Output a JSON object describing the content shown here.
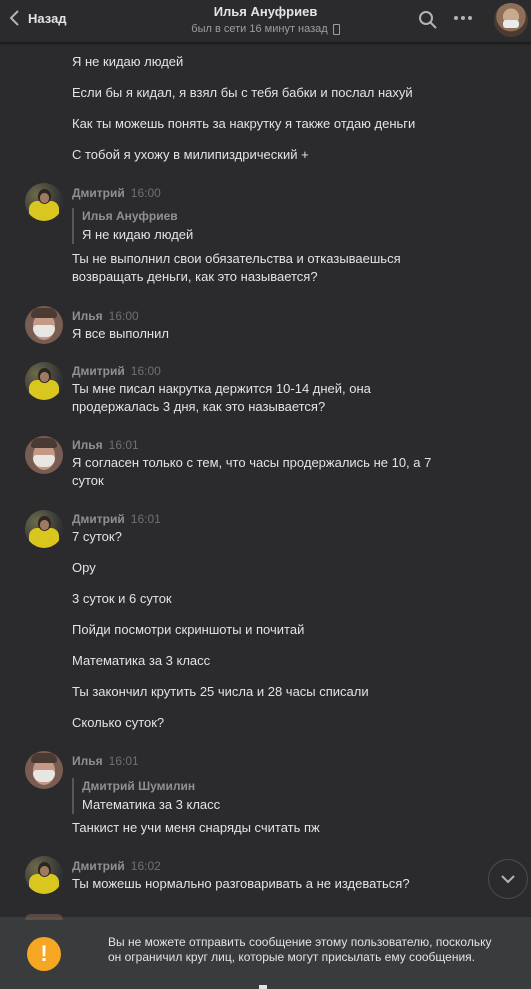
{
  "header": {
    "back_label": "Назад",
    "title": "Илья Ануфриев",
    "status": "был в сети 16 минут назад"
  },
  "messages": {
    "m1": "Я не кидаю людей",
    "m2": "Если бы я кидал, я взял бы с тебя бабки и послал нахуй",
    "m3": "Как ты можешь понять за накрутку я также отдаю деньги",
    "m4": "С тобой я ухожу в милипиздрический +",
    "g1": {
      "author": "Дмитрий",
      "time": "16:00",
      "quote_author": "Илья Ануфриев",
      "quote_text": "Я не кидаю людей",
      "text": "Ты не выполнил свои обязательства и отказываешься\nвозвращать деньги, как это называется?"
    },
    "g2": {
      "author": "Илья",
      "time": "16:00",
      "text": "Я все выполнил"
    },
    "g3": {
      "author": "Дмитрий",
      "time": "16:00",
      "text": "Ты мне писал накрутка держится 10-14 дней, она\nпродержалась 3 дня, как это называется?"
    },
    "g4": {
      "author": "Илья",
      "time": "16:01",
      "text": "Я согласен только с тем, что часы продержались не 10, а 7\nсуток"
    },
    "g5": {
      "author": "Дмитрий",
      "time": "16:01",
      "texts": [
        "7 суток?",
        "Ору",
        "3 суток и 6 суток",
        "Пойди посмотри скриншоты и почитай",
        "Математика за 3 класс",
        "Ты закончил крутить 25 числа и 28 часы списали",
        "Сколько суток?"
      ]
    },
    "g6": {
      "author": "Илья",
      "time": "16:01",
      "quote_author": "Дмитрий Шумилин",
      "quote_text": "Математика за 3 класс",
      "text": "Танкист не учи меня снаряды считать пж"
    },
    "g7": {
      "author": "Дмитрий",
      "time": "16:02",
      "text": "Ты можешь нормально разговаривать а не издеваться?"
    }
  },
  "footer": {
    "warning_text": "Вы не можете отправить сообщение этому пользователю, поскольку он ограничил круг лиц, которые могут присылать ему сообщения.",
    "warning_icon": "!"
  },
  "colors": {
    "background": "#2b2b2d",
    "accent_warning": "#f5a623",
    "text": "#e1e3e6",
    "muted": "#8d9196"
  }
}
